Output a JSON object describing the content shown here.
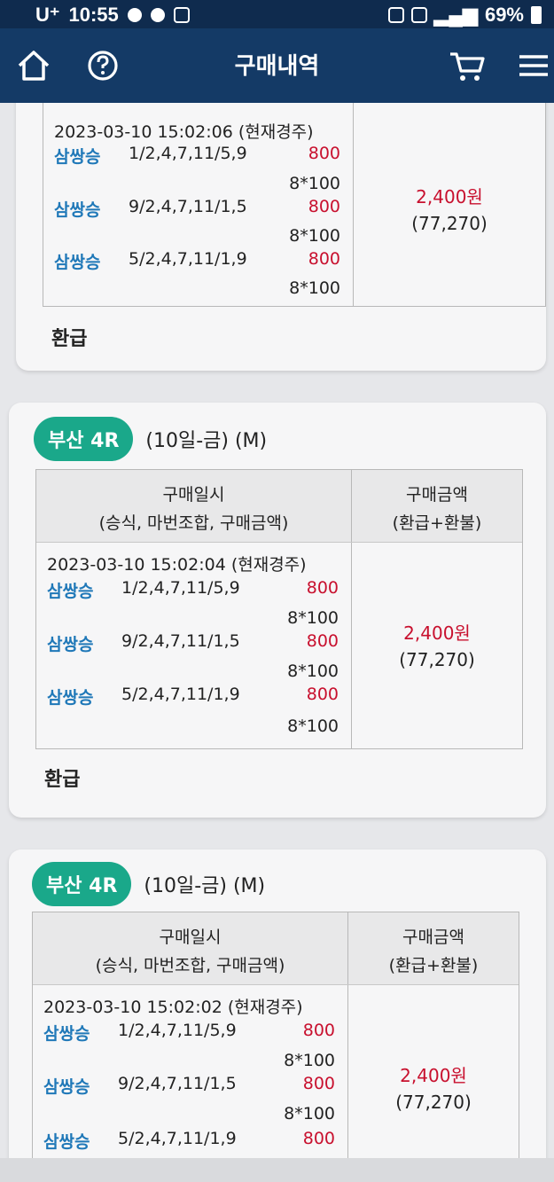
{
  "statusbar": {
    "carrier": "U⁺",
    "time": "10:55",
    "battery": "69%"
  },
  "header": {
    "title": "구매내역"
  },
  "columns": {
    "date_label": "구매일시",
    "date_sub": "(승식, 마번조합, 구매금액)",
    "amount_label": "구매금액",
    "amount_sub": "(환급+환불)"
  },
  "cards": [
    {
      "race": "",
      "race_info": "",
      "timestamp": "2023-03-10 15:02:06 (현재경주)",
      "bets": [
        {
          "type": "삼쌍승",
          "combo": "1/2,4,7,11/5,9",
          "amount": "800",
          "calc": "8*100"
        },
        {
          "type": "삼쌍승",
          "combo": "9/2,4,7,11/1,5",
          "amount": "800",
          "calc": "8*100"
        },
        {
          "type": "삼쌍승",
          "combo": "5/2,4,7,11/1,9",
          "amount": "800",
          "calc": "8*100"
        }
      ],
      "total": "2,400원",
      "total_sub": "(77,270)",
      "status": "환급"
    },
    {
      "race": "부산 4R",
      "race_info": "(10일-금) (M)",
      "timestamp": "2023-03-10 15:02:04 (현재경주)",
      "bets": [
        {
          "type": "삼쌍승",
          "combo": "1/2,4,7,11/5,9",
          "amount": "800",
          "calc": "8*100"
        },
        {
          "type": "삼쌍승",
          "combo": "9/2,4,7,11/1,5",
          "amount": "800",
          "calc": "8*100"
        },
        {
          "type": "삼쌍승",
          "combo": "5/2,4,7,11/1,9",
          "amount": "800",
          "calc": "8*100"
        }
      ],
      "total": "2,400원",
      "total_sub": "(77,270)",
      "status": "환급"
    },
    {
      "race": "부산 4R",
      "race_info": "(10일-금) (M)",
      "timestamp": "2023-03-10 15:02:02 (현재경주)",
      "bets": [
        {
          "type": "삼쌍승",
          "combo": "1/2,4,7,11/5,9",
          "amount": "800",
          "calc": "8*100"
        },
        {
          "type": "삼쌍승",
          "combo": "9/2,4,7,11/1,5",
          "amount": "800",
          "calc": "8*100"
        },
        {
          "type": "삼쌍승",
          "combo": "5/2,4,7,11/1,9",
          "amount": "800",
          "calc": ""
        }
      ],
      "total": "2,400원",
      "total_sub": "(77,270)",
      "status": ""
    }
  ],
  "colors": {
    "header_bg": "#143a66",
    "badge_green": "#1aa88a",
    "bet_type_blue": "#1f78b8",
    "amount_red": "#c8102e"
  },
  "icons": [
    "home-icon",
    "help-icon",
    "cart-icon",
    "menu-icon"
  ]
}
